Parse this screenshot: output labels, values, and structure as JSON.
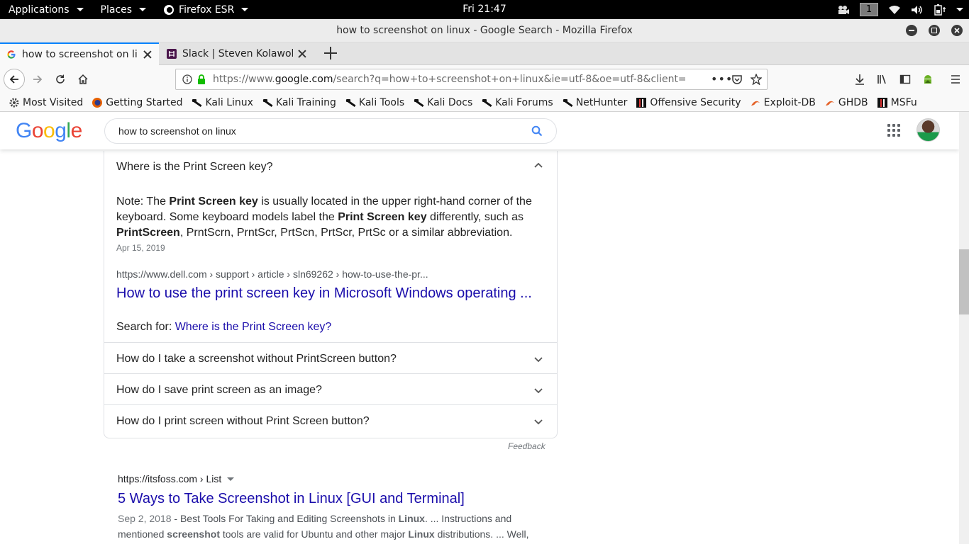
{
  "panel": {
    "applications": "Applications",
    "places": "Places",
    "firefox": "Firefox ESR",
    "clock": "Fri 21:47",
    "workspace": "1"
  },
  "window": {
    "title": "how to screenshot on linux - Google Search - Mozilla Firefox"
  },
  "tabs": [
    {
      "label": "how to screenshot on linux"
    },
    {
      "label": "Slack | Steven Kolawole |"
    }
  ],
  "urlbar": {
    "prefix": "https://www.",
    "host": "google.com",
    "path": "/search?q=how+to+screenshot+on+linux&ie=utf-8&oe=utf-8&client=firefox"
  },
  "bookmarks": [
    {
      "label": "Most Visited",
      "icon": "gear-icon"
    },
    {
      "label": "Getting Started",
      "icon": "firefox-icon"
    },
    {
      "label": "Kali Linux",
      "icon": "kali-dragon-icon"
    },
    {
      "label": "Kali Training",
      "icon": "kali-dragon-icon"
    },
    {
      "label": "Kali Tools",
      "icon": "kali-dragon-icon"
    },
    {
      "label": "Kali Docs",
      "icon": "kali-dragon-icon"
    },
    {
      "label": "Kali Forums",
      "icon": "kali-dragon-icon"
    },
    {
      "label": "NetHunter",
      "icon": "kali-dragon-icon"
    },
    {
      "label": "Offensive Security",
      "icon": "offsec-icon"
    },
    {
      "label": "Exploit-DB",
      "icon": "exploitdb-icon"
    },
    {
      "label": "GHDB",
      "icon": "exploitdb-icon"
    },
    {
      "label": "MSFu",
      "icon": "offsec-icon"
    }
  ],
  "google": {
    "logo": "Google",
    "query": "how to screenshot on linux"
  },
  "paa": {
    "expanded_question": "Where is the Print Screen key?",
    "snippet": {
      "p1": "Note: The ",
      "b1": "Print Screen key",
      "p2": " is usually located in the upper right-hand corner of the keyboard. Some keyboard models label the ",
      "b2": "Print Screen key",
      "p3": " differently, such as ",
      "b3": "PrintScreen",
      "p4": ", PrntScrn, PrntScr, PrtScn, PrtScr, PrtSc or a similar abbreviation."
    },
    "date": "Apr 15, 2019",
    "cite": "https://www.dell.com › support › article › sln69262 › how-to-use-the-pr...",
    "result_title": "How to use the print screen key in Microsoft Windows operating ...",
    "search_for_label": "Search for: ",
    "search_for_link": "Where is the Print Screen key?",
    "questions": [
      "How do I take a screenshot without PrintScreen button?",
      "How do I save print screen as an image?",
      "How do I print screen without Print Screen button?"
    ],
    "feedback": "Feedback"
  },
  "result": {
    "cite": "https://itsfoss.com › List",
    "title": "5 Ways to Take Screenshot in Linux [GUI and Terminal]",
    "date": "Sep 2, 2018",
    "desc_parts": [
      " - Best Tools For Taking and Editing Screenshots in ",
      "Linux",
      ". ... Instructions and mentioned ",
      "screenshot",
      " tools are valid for Ubuntu and other major ",
      "Linux",
      " distributions. ... Well,"
    ]
  },
  "colors": {
    "link": "#1a0dab",
    "tab_accent": "#0a84ff",
    "google_blue": "#4285f4",
    "google_red": "#ea4335",
    "google_yellow": "#fbbc05",
    "google_green": "#34a853",
    "lock_green": "#12bc00"
  }
}
